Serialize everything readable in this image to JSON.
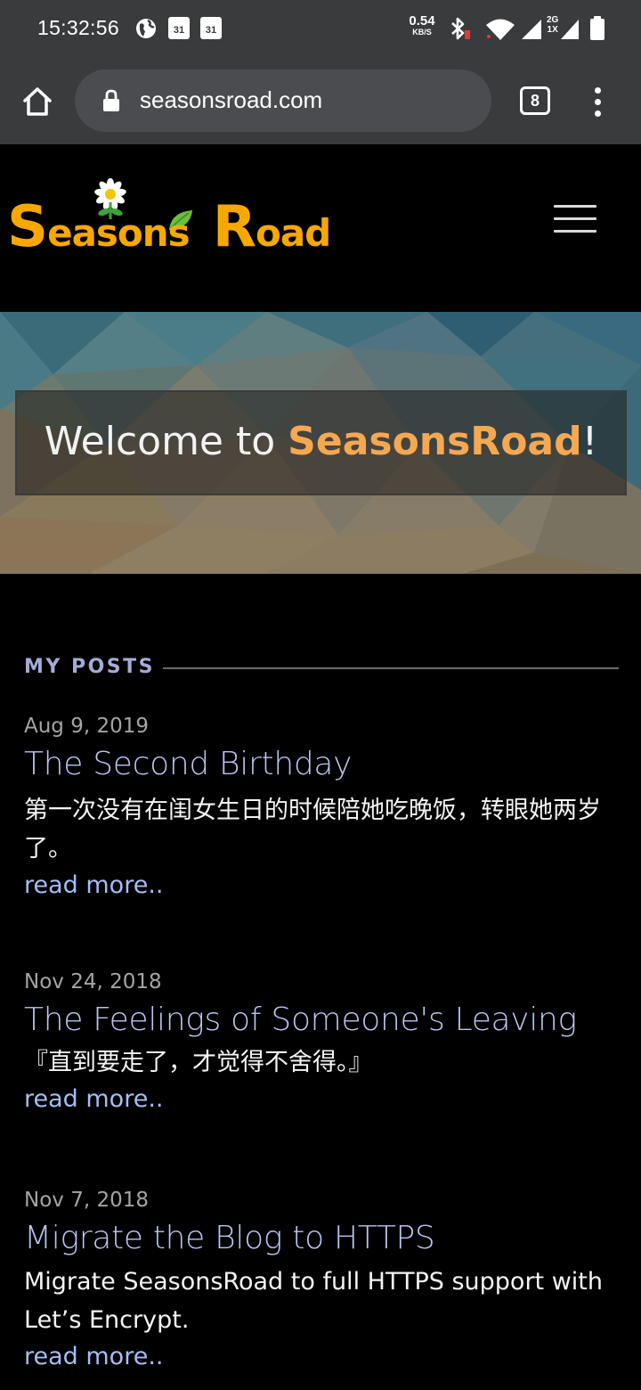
{
  "status_bar": {
    "time": "15:32:56",
    "calendar_day_1": "31",
    "calendar_day_2": "31",
    "net_speed_value": "0.54",
    "net_speed_unit": "KB/S",
    "network_type_top": "2G",
    "network_type_bottom": "1X"
  },
  "browser": {
    "url": "seasonsroad.com",
    "tab_count": "8"
  },
  "site": {
    "logo_text_part1_big": "S",
    "logo_text_part1_small": "easons",
    "logo_text_part2_big": "R",
    "logo_text_part2_small": "oad",
    "brand_color": "#f7a800"
  },
  "hero": {
    "welcome_prefix": "Welcome to ",
    "welcome_brand": "SeasonsRoad",
    "welcome_suffix": "!"
  },
  "posts_section": {
    "title": "MY POSTS",
    "posts": [
      {
        "date": "Aug 9, 2019",
        "title": "The Second Birthday",
        "excerpt": "第一次没有在闺女生日的时候陪她吃晚饭，转眼她两岁了。",
        "read_more": "read more.."
      },
      {
        "date": "Nov 24, 2018",
        "title": "The Feelings of Someone's Leaving",
        "excerpt": "『直到要走了，才觉得不舍得。』",
        "read_more": "read more.."
      },
      {
        "date": "Nov 7, 2018",
        "title": "Migrate the Blog to HTTPS",
        "excerpt": "Migrate SeasonsRoad to full HTTPS support with Let’s Encrypt.",
        "read_more": "read more.."
      }
    ]
  }
}
